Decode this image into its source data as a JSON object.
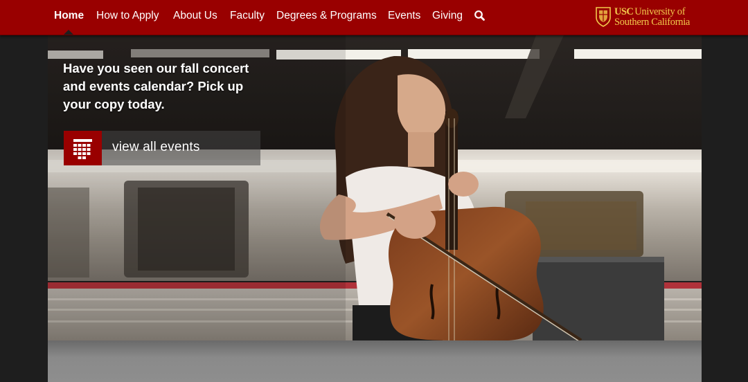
{
  "nav": {
    "items": [
      {
        "label": "Home",
        "active": true
      },
      {
        "label": "How to Apply"
      },
      {
        "label": "About Us"
      },
      {
        "label": "Faculty"
      },
      {
        "label": "Degrees & Programs"
      },
      {
        "label": "Events"
      },
      {
        "label": "Giving"
      }
    ],
    "search_icon": "search-icon",
    "logo": {
      "mark": "USC",
      "line1": "University of",
      "line2": "Southern California"
    }
  },
  "hero": {
    "promo": "Have you seen our fall concert and events calendar? Pick up your copy today.",
    "events_button": "view all events",
    "events_icon": "calendar-icon"
  },
  "colors": {
    "brand_red": "#990000",
    "logo_gold": "#f2c94c",
    "background": "#1e1e1e"
  }
}
